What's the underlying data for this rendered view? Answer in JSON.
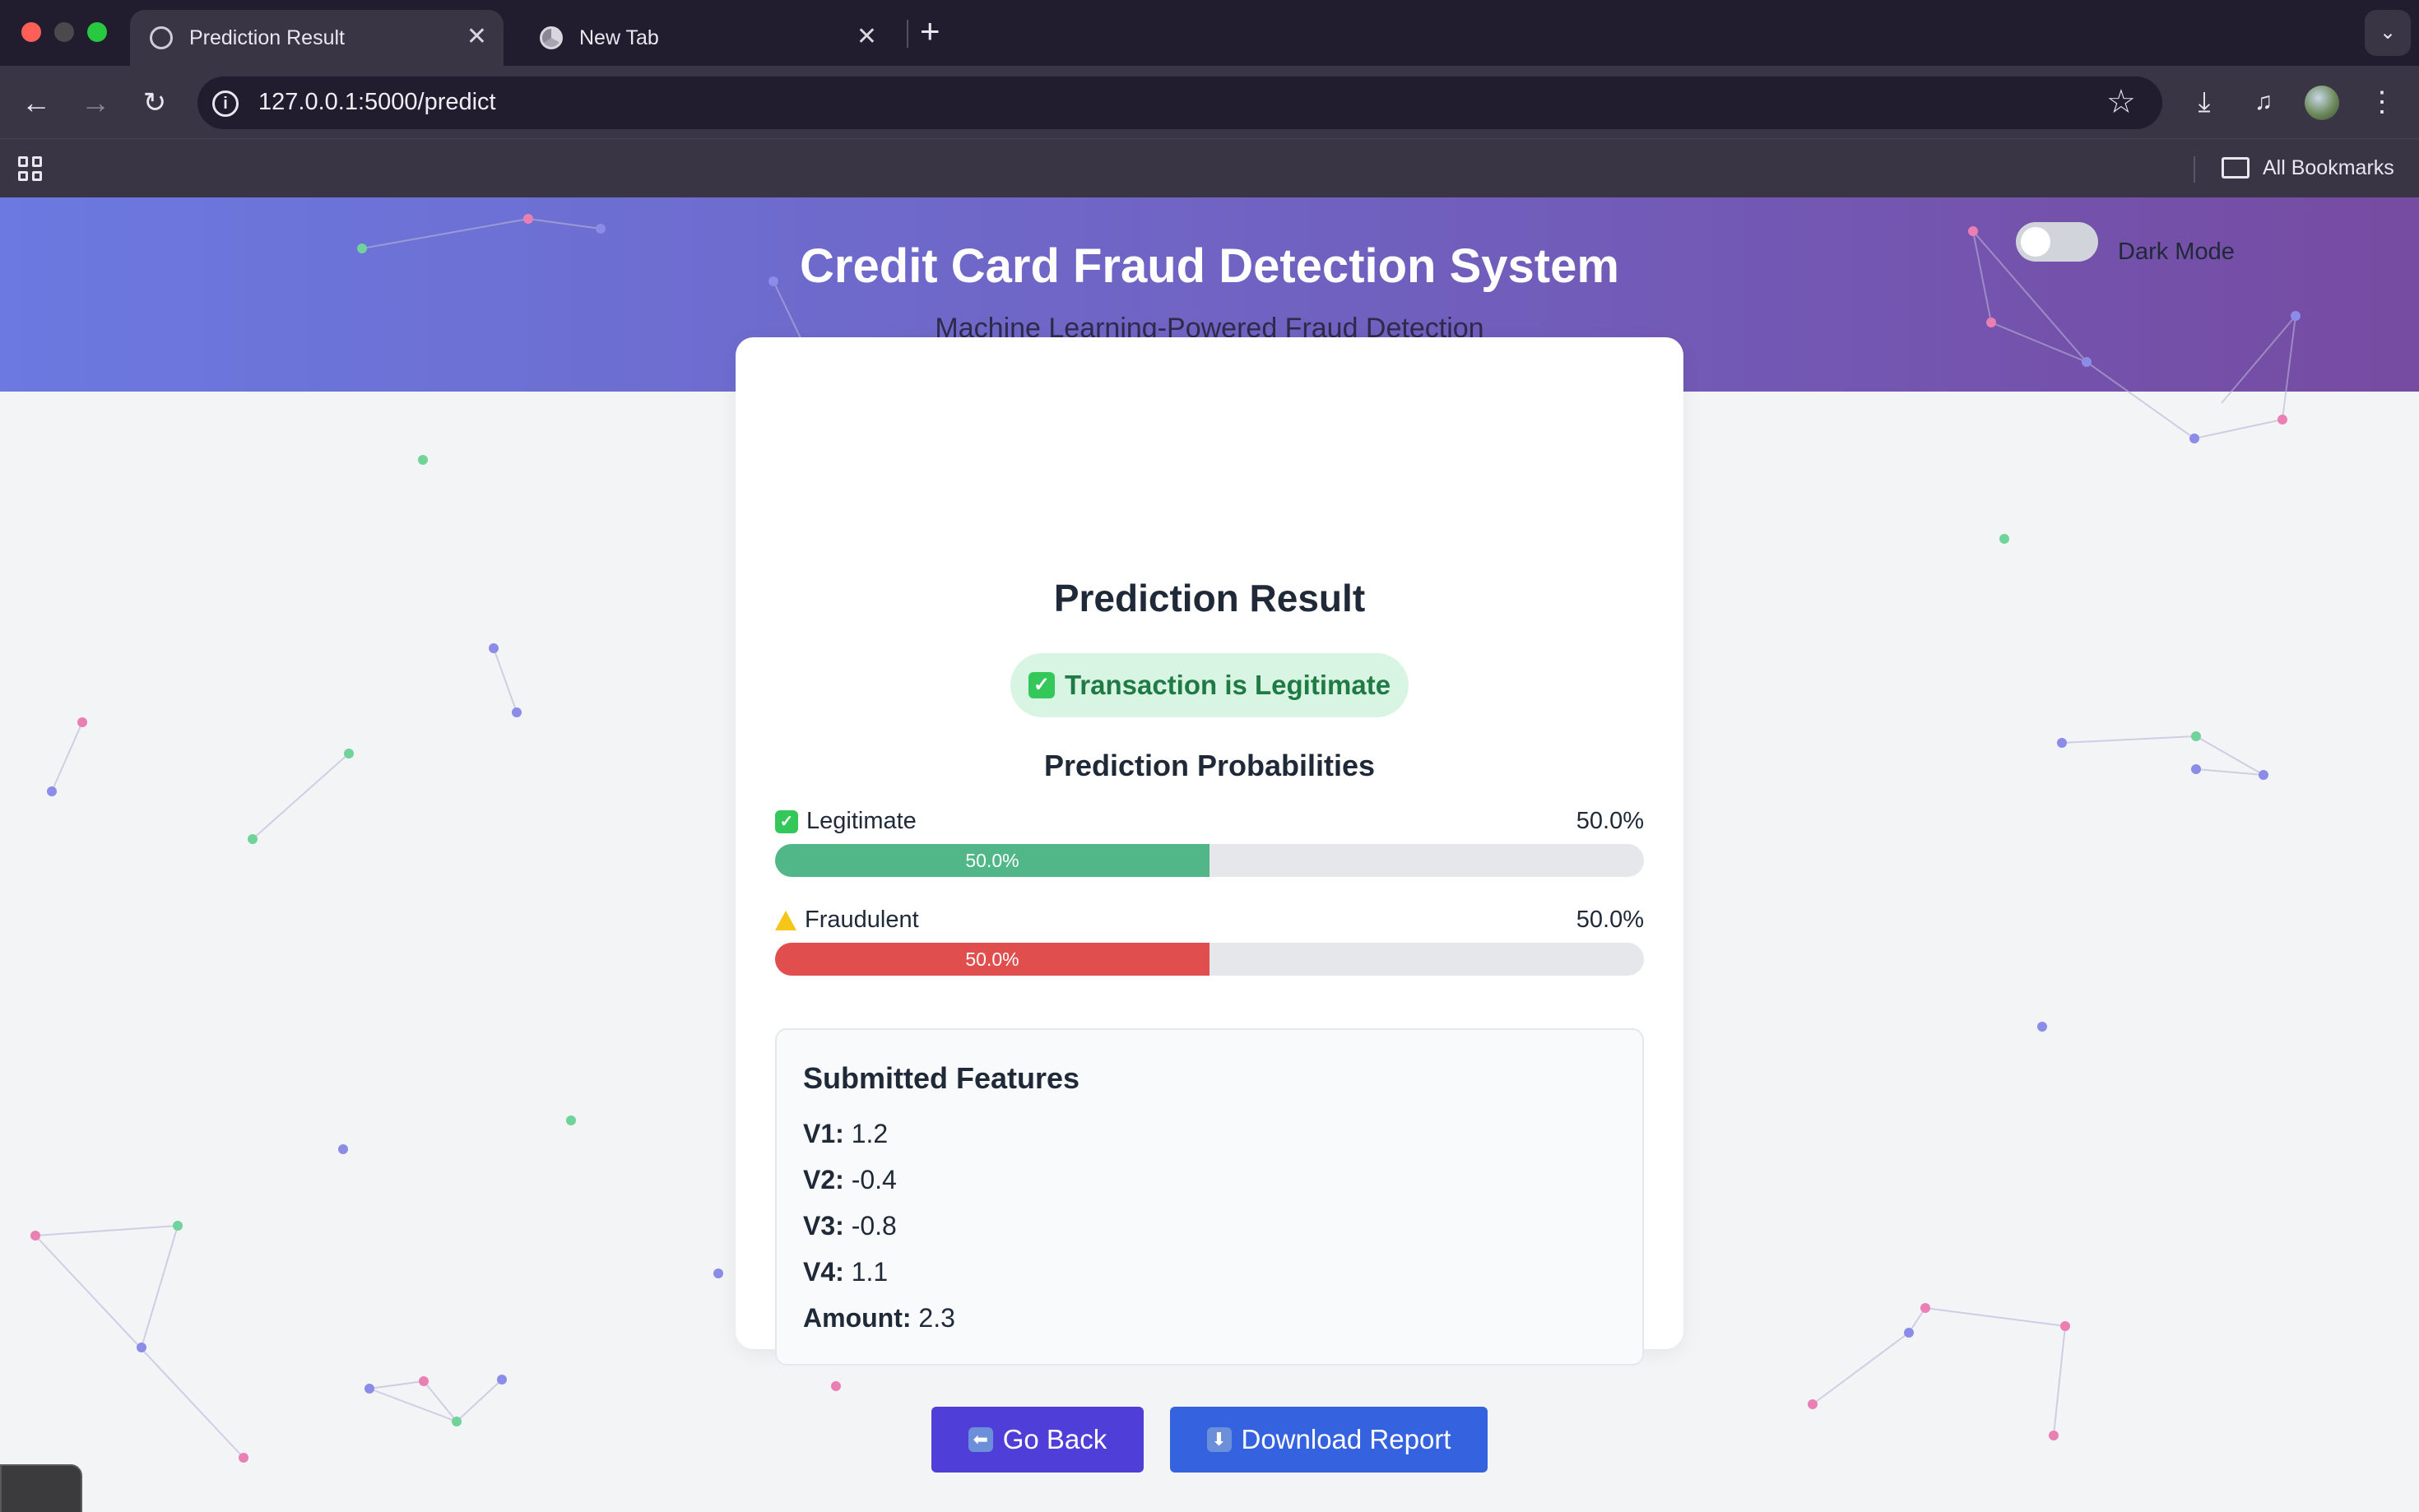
{
  "browser": {
    "tabs": [
      {
        "title": "Prediction Result",
        "active": true
      },
      {
        "title": "New Tab",
        "active": false
      }
    ],
    "new_tab_glyph": "+",
    "close_glyph": "✕",
    "url": "127.0.0.1:5000/predict",
    "bookmarks_label": "All Bookmarks",
    "traffic_colors": {
      "close": "#ff5f57",
      "minimize": "#4a4a4c",
      "zoom": "#28c840"
    }
  },
  "header": {
    "title": "Credit Card Fraud Detection System",
    "subtitle": "Machine Learning-Powered Fraud Detection",
    "gradient_start": "#6b79e0",
    "gradient_end": "#764ba2"
  },
  "dark_mode": {
    "label": "Dark Mode",
    "enabled": false
  },
  "result": {
    "title": "Prediction Result",
    "badge": "Transaction is Legitimate",
    "probabilities_title": "Prediction Probabilities",
    "probabilities": [
      {
        "label": "Legitimate",
        "value_text": "50.0%",
        "fraction": 0.5,
        "color": "#52b788",
        "icon": "check-icon"
      },
      {
        "label": "Fraudulent",
        "value_text": "50.0%",
        "fraction": 0.5,
        "color": "#e04e4e",
        "icon": "warning-icon"
      }
    ]
  },
  "features": {
    "title": "Submitted Features",
    "items": [
      {
        "key": "V1:",
        "value": "1.2"
      },
      {
        "key": "V2:",
        "value": "-0.4"
      },
      {
        "key": "V3:",
        "value": "-0.8"
      },
      {
        "key": "V4:",
        "value": "1.1"
      },
      {
        "key": "Amount:",
        "value": "2.3"
      }
    ]
  },
  "actions": {
    "back_label": "Go Back",
    "download_label": "Download Report"
  }
}
